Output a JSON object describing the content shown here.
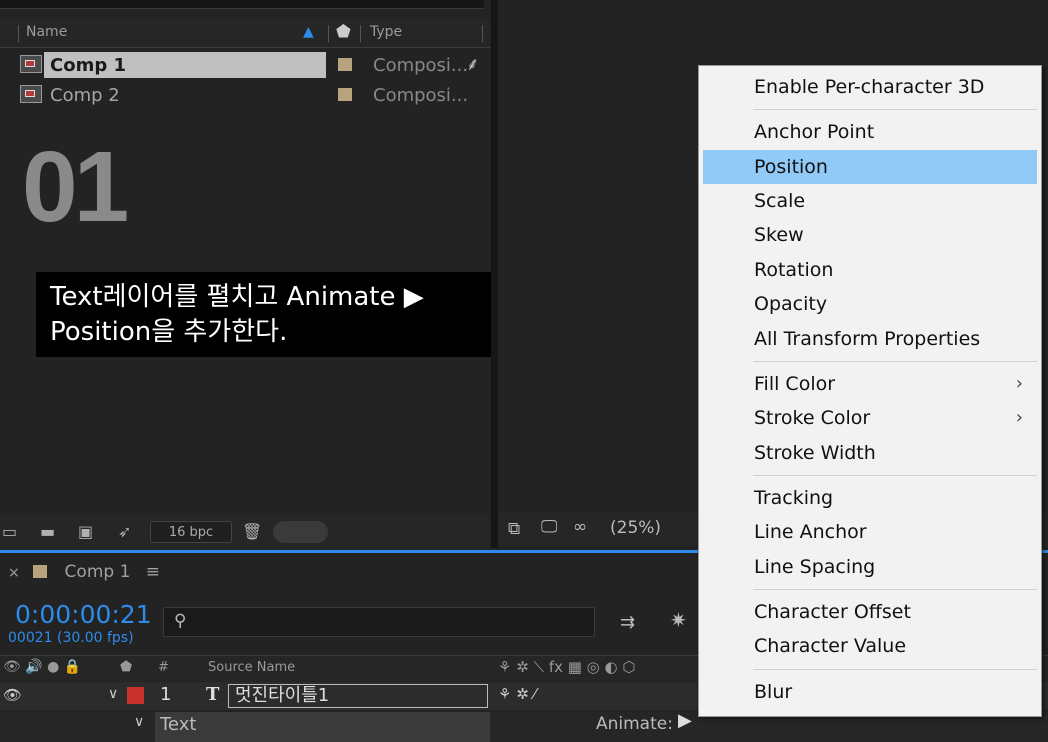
{
  "project": {
    "columns": {
      "name": "Name",
      "type": "Type"
    },
    "items": [
      {
        "name": "Comp 1",
        "type": "Composi..."
      },
      {
        "name": "Comp 2",
        "type": "Composi..."
      }
    ],
    "bpc": "16 bpc"
  },
  "overlay": {
    "step": "01",
    "caption_line1": "Text레이어를 펼치고 Animate ▶",
    "caption_line2": "Position을 추가한다."
  },
  "viewer": {
    "zoom": "(25%)"
  },
  "timeline": {
    "tab": "Comp 1",
    "timecode": "0:00:00:21",
    "frames": "00021 (30.00 fps)",
    "header_source": "Source Name",
    "layer_number": "1",
    "layer_name": "멋진타이틀1",
    "text_label": "Text",
    "animate_label": "Animate:"
  },
  "context_menu": {
    "items": [
      {
        "label": "Enable Per-character 3D"
      },
      {
        "label": "Anchor Point"
      },
      {
        "label": "Position",
        "selected": true
      },
      {
        "label": "Scale"
      },
      {
        "label": "Skew"
      },
      {
        "label": "Rotation"
      },
      {
        "label": "Opacity"
      },
      {
        "label": "All Transform Properties"
      },
      {
        "label": "Fill Color",
        "submenu": true
      },
      {
        "label": "Stroke Color",
        "submenu": true
      },
      {
        "label": "Stroke Width"
      },
      {
        "label": "Tracking"
      },
      {
        "label": "Line Anchor"
      },
      {
        "label": "Line Spacing"
      },
      {
        "label": "Character Offset"
      },
      {
        "label": "Character Value"
      },
      {
        "label": "Blur"
      }
    ]
  },
  "colors": {
    "accent": "#2d8ceb",
    "menu_highlight": "#91c9f7",
    "layer_label": "#c8312d",
    "comp_swatch": "#b7a37e"
  }
}
